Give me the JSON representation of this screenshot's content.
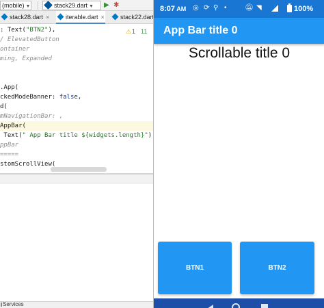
{
  "ide": {
    "toolbar": {
      "device": "(mobile)",
      "run_config": "stack29.dart",
      "run_icon": "play-icon",
      "debug_icon": "debug-icon"
    },
    "tabs": [
      {
        "label": "stack28.dart",
        "icon": "dart-file-icon",
        "active": false
      },
      {
        "label": "iterable.dart",
        "icon": "dart-file-icon",
        "active": true
      },
      {
        "label": "stack22.dart",
        "icon": "dart-file-icon",
        "active": false
      }
    ],
    "code_lines": [
      {
        "segments": [
          {
            "t": ": ",
            "c": ""
          },
          {
            "t": "Text",
            "c": "class"
          },
          {
            "t": "(",
            "c": ""
          },
          {
            "t": "\"BTN2\"",
            "c": "string"
          },
          {
            "t": "),",
            "c": ""
          }
        ]
      },
      {
        "segments": [
          {
            "t": "/ ElevatedButton",
            "c": "comment"
          }
        ]
      },
      {
        "segments": [
          {
            "t": "ontainer",
            "c": "comment"
          }
        ]
      },
      {
        "segments": [
          {
            "t": "ming, Expanded",
            "c": "comment"
          }
        ]
      },
      {
        "segments": []
      },
      {
        "segments": []
      },
      {
        "segments": [
          {
            "t": ".App(",
            "c": ""
          }
        ]
      },
      {
        "segments": [
          {
            "t": "ckedModeBanner: ",
            "c": ""
          },
          {
            "t": "false",
            "c": "key"
          },
          {
            "t": ",",
            "c": ""
          }
        ]
      },
      {
        "segments": [
          {
            "t": "d(",
            "c": ""
          }
        ]
      },
      {
        "segments": [
          {
            "t": "mNavigationBar: ,",
            "c": "comment"
          }
        ]
      },
      {
        "segments": [
          {
            "t": "AppBar(",
            "c": ""
          }
        ]
      },
      {
        "segments": [
          {
            "t": " Text(",
            "c": ""
          },
          {
            "t": "\" App Bar title ${widgets.length}\"",
            "c": "string"
          },
          {
            "t": "),",
            "c": ""
          }
        ]
      },
      {
        "segments": [
          {
            "t": "ppBar",
            "c": "comment"
          }
        ]
      },
      {
        "segments": [
          {
            "t": "=====",
            "c": "comment"
          }
        ]
      },
      {
        "segments": [
          {
            "t": "stomScrollView(",
            "c": ""
          }
        ]
      }
    ],
    "warnings": {
      "warn_count": "1",
      "hint_count": "11"
    },
    "status": {
      "services_label": "Services"
    }
  },
  "phone": {
    "statusbar": {
      "time": "8:07",
      "am_pm": "AM",
      "battery_percent": "100%",
      "left_icons": [
        "whatsapp-icon",
        "sync-icon",
        "broadcast-icon",
        "dot-icon"
      ],
      "right_icons": [
        "mute-icon",
        "wifi-icon",
        "signal-icon",
        "battery-icon"
      ]
    },
    "appbar": {
      "title": "App Bar title 0"
    },
    "body": {
      "scroll_title": "Scrollable title 0"
    },
    "buttons": [
      {
        "label": "BTN1"
      },
      {
        "label": "BTN2"
      }
    ],
    "navbar": {
      "icons": [
        "back-icon",
        "home-icon",
        "recents-icon"
      ]
    }
  },
  "colors": {
    "appbar": "#2196f3",
    "statusbar": "#1976d2",
    "button": "#2196f3",
    "navbar": "#1e4fa8"
  }
}
